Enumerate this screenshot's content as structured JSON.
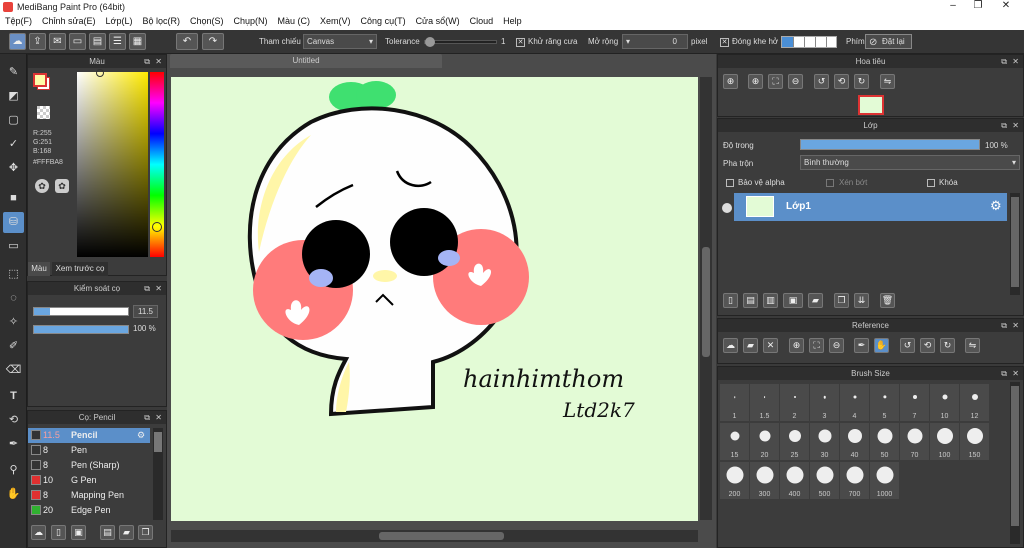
{
  "window": {
    "title": "MediBang Paint Pro (64bit)"
  },
  "menu": [
    "Tệp(F)",
    "Chỉnh sửa(E)",
    "Lớp(L)",
    "Bộ lọc(R)",
    "Chọn(S)",
    "Chụp(N)",
    "Màu (C)",
    "Xem(V)",
    "Công cụ(T)",
    "Cửa sổ(W)",
    "Cloud",
    "Help"
  ],
  "toolbar": {
    "reference_label": "Tham chiếu",
    "reference_value": "Canvas",
    "tolerance_label": "Tolerance",
    "tolerance_value": "1",
    "antialias_label": "Khử răng cưa",
    "expand_label": "Mở rộng",
    "expand_value": "0",
    "expand_unit": "pixel",
    "close_gap_label": "Đóng khe hở",
    "key_label": "Phím",
    "reset_label": "Đặt lại"
  },
  "color_panel": {
    "title": "Màu",
    "r": "R:255",
    "g": "G:251",
    "b": "B:168",
    "hex": "#FFFBA8",
    "tab_color": "Màu",
    "tab_preview": "Xem trước cọ",
    "primary_color": "#FFFBA8",
    "secondary_color": "#FFFFFF"
  },
  "brush_control": {
    "title": "Kiểm soát cọ",
    "size_value": "11.5",
    "opacity_value": "100 %",
    "opacity_fraction": 1.0,
    "size_fraction": 0.17
  },
  "brush_list": {
    "title": "Cọ: Pencil",
    "items": [
      {
        "size": "11.5",
        "name": "Pencil",
        "color": "#333333"
      },
      {
        "size": "8",
        "name": "Pen",
        "color": "#333333"
      },
      {
        "size": "8",
        "name": "Pen (Sharp)",
        "color": "#333333"
      },
      {
        "size": "10",
        "name": "G Pen",
        "color": "#e03030"
      },
      {
        "size": "8",
        "name": "Mapping Pen",
        "color": "#e03030"
      },
      {
        "size": "20",
        "name": "Edge Pen",
        "color": "#30b030"
      }
    ]
  },
  "document": {
    "tab_title": "Untitled",
    "signature_line1": "hainhimthom",
    "signature_line2": "Ltd2k7"
  },
  "navigator": {
    "title": "Hoa tiêu"
  },
  "layer_panel": {
    "title": "Lớp",
    "opacity_label": "Độ trong",
    "opacity_value": "100 %",
    "opacity_fraction": 1.0,
    "blend_label": "Pha trộn",
    "blend_value": "Bình thường",
    "protect_alpha": "Bảo vệ alpha",
    "clip": "Xén bớt",
    "lock": "Khóa",
    "layer_name": "Lớp1"
  },
  "reference_panel": {
    "title": "Reference"
  },
  "brush_size_panel": {
    "title": "Brush Size",
    "sizes": [
      "1",
      "1.5",
      "2",
      "3",
      "4",
      "5",
      "7",
      "10",
      "12",
      "15",
      "20",
      "25",
      "30",
      "40",
      "50",
      "70",
      "100",
      "150",
      "200",
      "300",
      "400",
      "500",
      "700",
      "1000"
    ]
  }
}
